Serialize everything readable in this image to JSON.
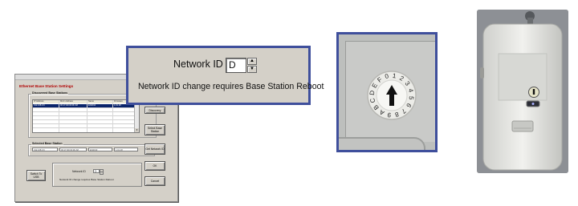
{
  "dialog": {
    "title": "Ethernet Base Station Settings",
    "discovered_group": "Discovered Base Stations",
    "columns": [
      "IP Address",
      "MAC Address",
      "Name",
      "Firmware"
    ],
    "rows": [
      [
        "192.168.0.6",
        "00:17:0D:00:0F:A8",
        "EN4013",
        "1.01.18"
      ]
    ],
    "selected_group": "Selected Base Station",
    "selected_values": [
      "192.168.0.6",
      "00:17:0D:00:0F:A8",
      "EN4013",
      "1.01.18"
    ],
    "buttons": {
      "discovery": "Discovery",
      "select_base": "Select Base Station",
      "get_network_id": "Get Network ID",
      "ok": "OK",
      "cancel": "Cancel",
      "switch_usb": "Switch To USB"
    },
    "network_id_label": "Network ID",
    "network_id_value": "D",
    "reboot_note": "Network ID change requires Base Station Reboot"
  },
  "zoom": {
    "network_id_label": "Network ID",
    "network_id_value": "D",
    "reboot_note": "Network ID change requires Base Station Reboot"
  },
  "rotary_switch": {
    "labels": [
      "A",
      "B",
      "C",
      "D",
      "E",
      "F",
      "0",
      "1",
      "2",
      "3",
      "4",
      "5",
      "6",
      "7",
      "8",
      "9"
    ]
  },
  "colors": {
    "frame_blue": "#3f4f9c",
    "dialog_title_red": "#b00000",
    "dialog_bg": "#d4d0c8",
    "selection_blue": "#0a246a"
  }
}
